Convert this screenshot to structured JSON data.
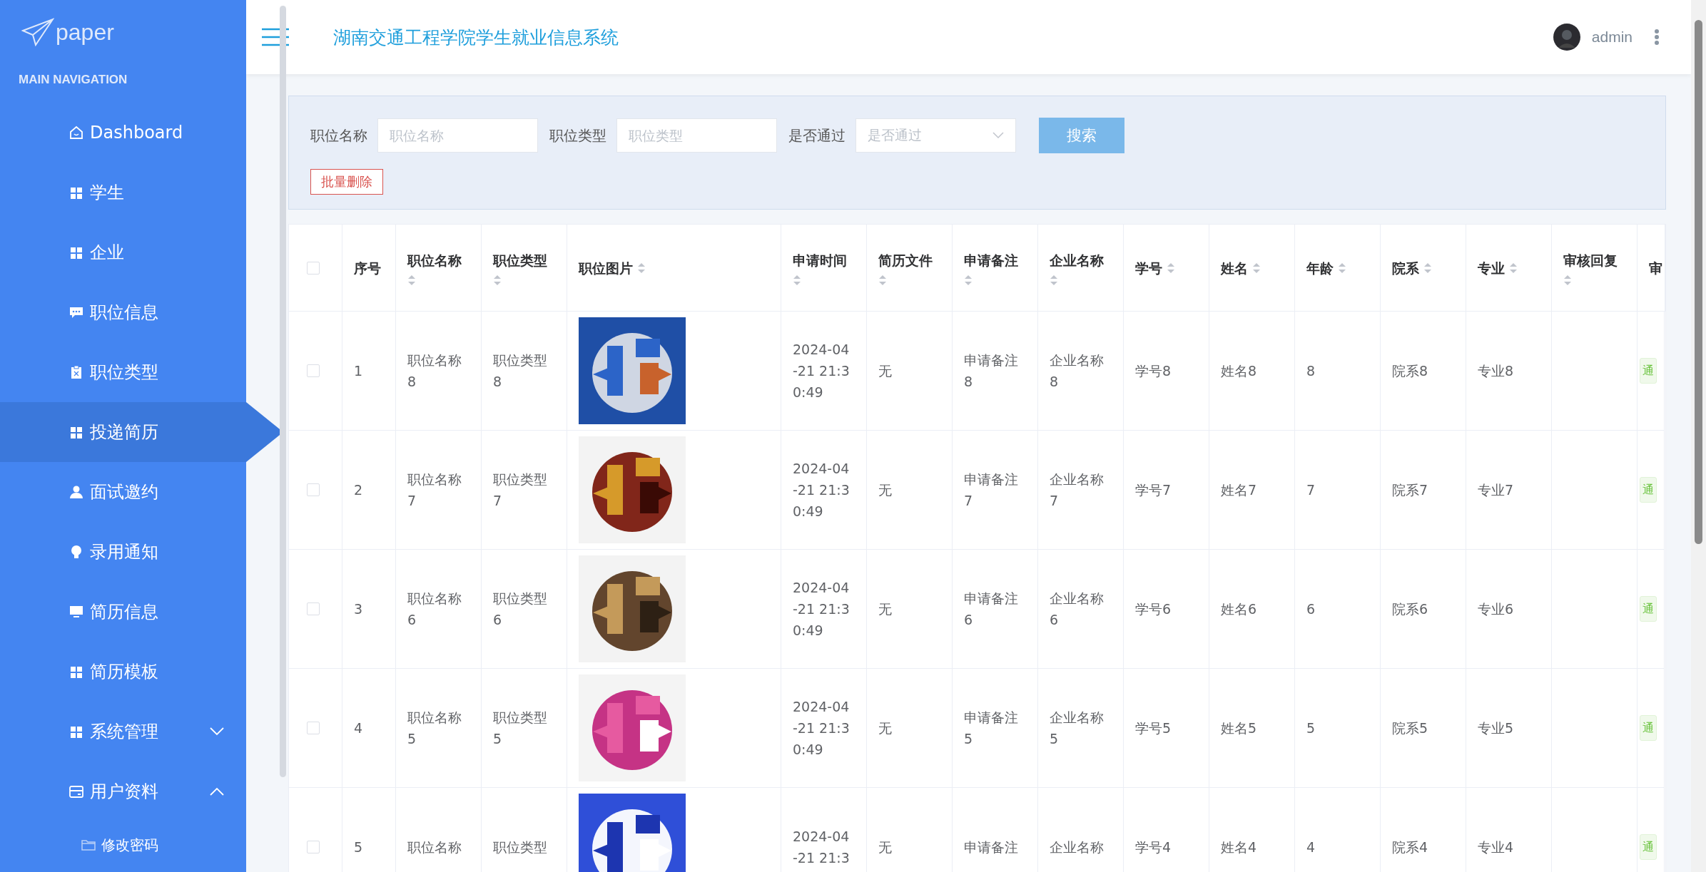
{
  "sidebar": {
    "logo": "paper",
    "section_title": "MAIN NAVIGATION",
    "items": [
      {
        "label": "Dashboard",
        "selected": false
      },
      {
        "label": "学生",
        "selected": false
      },
      {
        "label": "企业",
        "selected": false
      },
      {
        "label": "职位信息",
        "selected": false
      },
      {
        "label": "职位类型",
        "selected": false
      },
      {
        "label": "投递简历",
        "selected": true
      },
      {
        "label": "面试邀约",
        "selected": false
      },
      {
        "label": "录用通知",
        "selected": false
      },
      {
        "label": "简历信息",
        "selected": false
      },
      {
        "label": "简历模板",
        "selected": false
      },
      {
        "label": "系统管理",
        "selected": false,
        "expanded": false
      },
      {
        "label": "用户资料",
        "selected": false,
        "expanded": true,
        "children": [
          {
            "label": "修改密码",
            "selected": false
          }
        ]
      }
    ]
  },
  "header": {
    "title": "湖南交通工程学院学生就业信息系统",
    "user": "admin"
  },
  "search": {
    "fields": [
      {
        "kind": "input",
        "label": "职位名称",
        "placeholder": "职位名称"
      },
      {
        "kind": "input",
        "label": "职位类型",
        "placeholder": "职位类型"
      },
      {
        "kind": "select",
        "label": "是否通过",
        "placeholder": "是否通过"
      }
    ],
    "search_button": "搜索",
    "delete_button": "批量删除"
  },
  "table": {
    "select_all": {
      "checked": false
    },
    "columns": [
      {
        "label": "序号",
        "sortable": false
      },
      {
        "label": "职位名称",
        "sortable": true
      },
      {
        "label": "职位类型",
        "sortable": true
      },
      {
        "label": "职位图片",
        "sortable": true
      },
      {
        "label": "申请时间",
        "sortable": true
      },
      {
        "label": "简历文件",
        "sortable": true
      },
      {
        "label": "申请备注",
        "sortable": true
      },
      {
        "label": "企业名称",
        "sortable": true
      },
      {
        "label": "学号",
        "sortable": true
      },
      {
        "label": "姓名",
        "sortable": true
      },
      {
        "label": "年龄",
        "sortable": true
      },
      {
        "label": "院系",
        "sortable": true
      },
      {
        "label": "专业",
        "sortable": true
      },
      {
        "label": "审核回复",
        "sortable": true
      },
      {
        "label": "审",
        "sortable": false
      }
    ],
    "rows": [
      {
        "checked": false,
        "cells": [
          "1",
          "职位名称8",
          "职位类型8",
          null,
          "2024-04-21 21:30:49",
          "无",
          "申请备注8",
          "企业名称8",
          "学号8",
          "姓名8",
          "8",
          "院系8",
          "专业8",
          null
        ],
        "status": "通"
      },
      {
        "checked": false,
        "cells": [
          "2",
          "职位名称7",
          "职位类型7",
          null,
          "2024-04-21 21:30:49",
          "无",
          "申请备注7",
          "企业名称7",
          "学号7",
          "姓名7",
          "7",
          "院系7",
          "专业7",
          null
        ],
        "status": "通"
      },
      {
        "checked": false,
        "cells": [
          "3",
          "职位名称6",
          "职位类型6",
          null,
          "2024-04-21 21:30:49",
          "无",
          "申请备注6",
          "企业名称6",
          "学号6",
          "姓名6",
          "6",
          "院系6",
          "专业6",
          null
        ],
        "status": "通"
      },
      {
        "checked": false,
        "cells": [
          "4",
          "职位名称5",
          "职位类型5",
          null,
          "2024-04-21 21:30:49",
          "无",
          "申请备注5",
          "企业名称5",
          "学号5",
          "姓名5",
          "5",
          "院系5",
          "专业5",
          null
        ],
        "status": "通"
      },
      {
        "checked": false,
        "cells": [
          "5",
          "职位名称",
          "职位类型",
          null,
          "2024-04-21 21:3",
          "无",
          "申请备注",
          "企业名称",
          "学号4",
          "姓名4",
          "4",
          "院系4",
          "专业4",
          null
        ],
        "status": "通"
      }
    ]
  }
}
